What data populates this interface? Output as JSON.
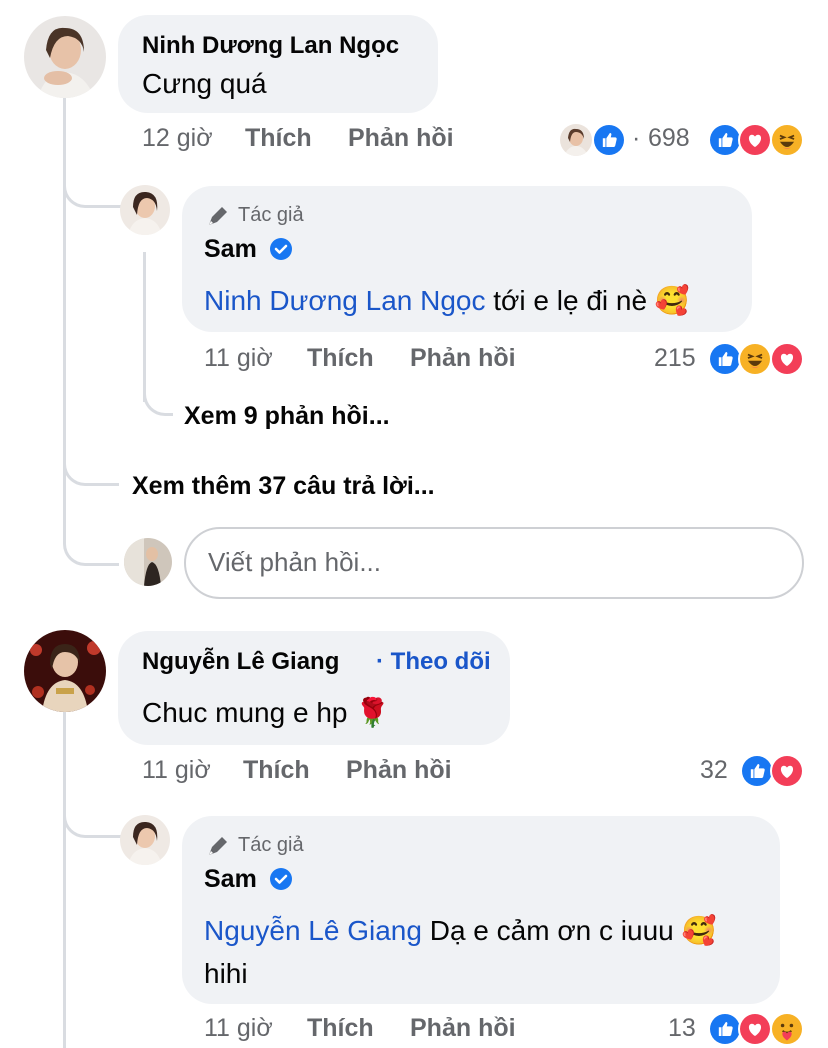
{
  "comments": [
    {
      "author": "Ninh Dương Lan Ngọc",
      "text": "Cưng quá",
      "time": "12 giờ",
      "like_label": "Thích",
      "reply_label": "Phản hồi",
      "reaction_count": "698",
      "reaction_icons": [
        "like-icon",
        "love-icon",
        "haha-icon"
      ],
      "replies": [
        {
          "author_tag": "Tác giả",
          "author": "Sam",
          "mention": "Ninh Dương Lan Ngọc",
          "text": "tới e lẹ đi nè",
          "emoji": "🥰",
          "time": "11 giờ",
          "like_label": "Thích",
          "reply_label": "Phản hồi",
          "reaction_count": "215",
          "reaction_icons": [
            "like-icon",
            "haha-icon",
            "love-icon"
          ],
          "view_replies": "Xem 9 phản hồi..."
        }
      ],
      "view_more": "Xem thêm 37 câu trả lời...",
      "reply_placeholder": "Viết phản hồi..."
    },
    {
      "author": "Nguyễn Lê Giang",
      "follow_label": "· Theo dõi",
      "text": "Chuc mung e hp",
      "emoji": "🌹",
      "time": "11 giờ",
      "like_label": "Thích",
      "reply_label": "Phản hồi",
      "reaction_count": "32",
      "reaction_icons": [
        "like-icon",
        "love-icon"
      ],
      "replies": [
        {
          "author_tag": "Tác giả",
          "author": "Sam",
          "mention": "Nguyễn Lê Giang",
          "text": "Dạ e cảm ơn c iuuu",
          "emoji": "🥰",
          "text_line2": "hihi",
          "time": "11 giờ",
          "like_label": "Thích",
          "reply_label": "Phản hồi",
          "reaction_count": "13",
          "reaction_icons": [
            "like-icon",
            "love-icon",
            "care-icon"
          ]
        }
      ]
    }
  ],
  "colors": {
    "bubble": "#f0f2f5",
    "meta_text": "#65676b",
    "link_blue": "#1a56c9",
    "like_blue": "#1877f2",
    "love_red": "#f33e58",
    "haha_yellow": "#f7b125",
    "thread_line": "#d9dce1"
  }
}
